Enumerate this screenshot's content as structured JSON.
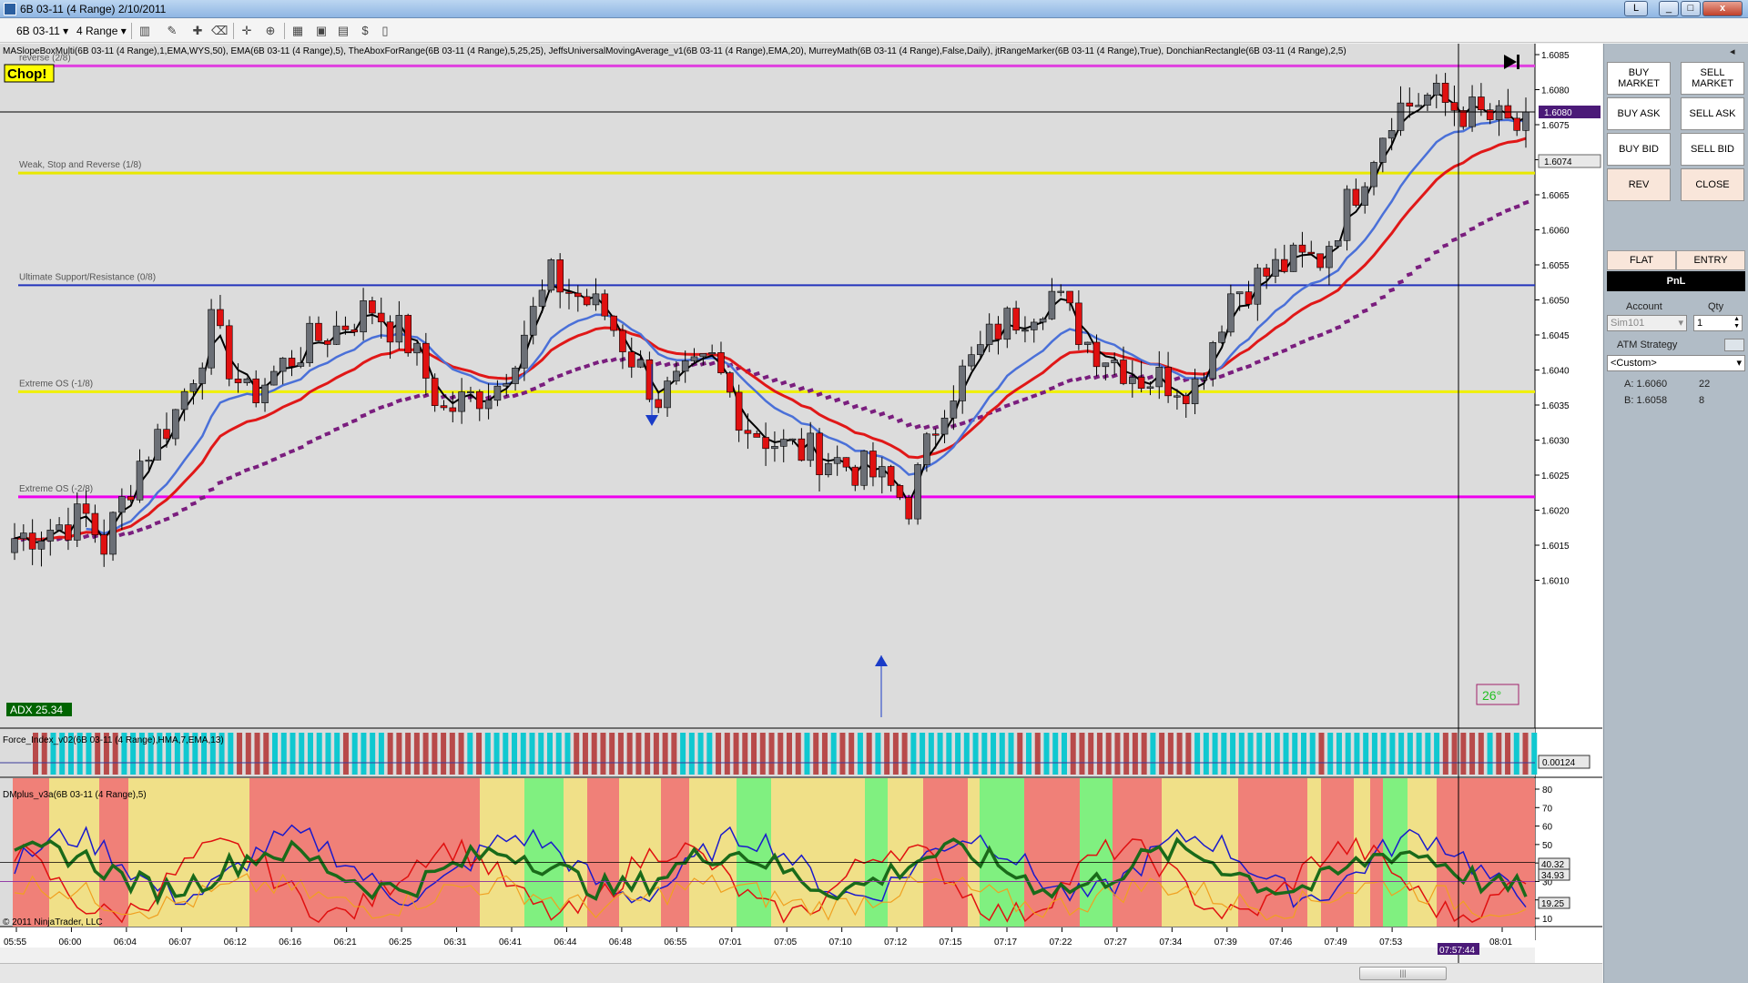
{
  "window": {
    "title": "6B 03-11 (4 Range)  2/10/2011",
    "buttons": [
      "L",
      "_",
      "□",
      "x"
    ]
  },
  "toolbar": {
    "instrument": "6B 03-11",
    "interval": "4 Range"
  },
  "chart": {
    "indicators_label": "MASlopeBoxMulti(6B 03-11 (4 Range),1,EMA,WYS,50), EMA(6B 03-11 (4 Range),5), TheAboxForRange(6B 03-11 (4 Range),5,25,25), JeffsUniversalMovingAverage_v1(6B 03-11 (4 Range),EMA,20), MurreyMath(6B 03-11 (4 Range),False,Daily), jtRangeMarker(6B 03-11 (4 Range),True), DonchianRectangle(6B 03-11 (4 Range),2,5)",
    "chop_label": "Chop!",
    "adx_label": "ADX 25.34",
    "angle_label": "26°",
    "murrey_lines": [
      {
        "label": "reverse (2/8)",
        "price": 1.60834,
        "color": "#e040e0"
      },
      {
        "label": "Weak, Stop and Reverse (1/8)",
        "price": 1.60681,
        "color": "#e8e800"
      },
      {
        "label": "Ultimate Support/Resistance (0/8)",
        "price": 1.60521,
        "color": "#2233bb"
      },
      {
        "label": "Extreme OS (-1/8)",
        "price": 1.60369,
        "color": "#f0f000"
      },
      {
        "label": "Extreme OS (-2/8)",
        "price": 1.60219,
        "color": "#ee00ee"
      }
    ],
    "price_axis": {
      "ticks": [
        "1.6085",
        "1.6080",
        "1.6075",
        "1.6070",
        "1.6065",
        "1.6060",
        "1.6055",
        "1.6050",
        "1.6045",
        "1.6040",
        "1.6035",
        "1.6030",
        "1.6025",
        "1.6020",
        "1.6015",
        "1.6010"
      ],
      "last_price_box": "1.6080",
      "current_price_box": "1.6074"
    },
    "time_axis": [
      "05:55",
      "06:00",
      "06:04",
      "06:07",
      "06:12",
      "06:16",
      "06:21",
      "06:25",
      "06:31",
      "06:41",
      "06:44",
      "06:48",
      "06:55",
      "07:01",
      "07:05",
      "07:10",
      "07:12",
      "07:15",
      "07:17",
      "07:22",
      "07:27",
      "07:34",
      "07:39",
      "07:46",
      "07:49",
      "07:53",
      "07:57:44",
      "08:01"
    ],
    "cursor_time": "07:57:44"
  },
  "force_panel": {
    "label": "Force_Index_v02(6B 03-11 (4 Range),HMA,7,EMA,13)",
    "value_box": "0.00124"
  },
  "dm_panel": {
    "label": "DMplus_v3a(6B 03-11 (4 Range),5)",
    "ticks": [
      "80",
      "70",
      "60",
      "50",
      "40",
      "30",
      "20",
      "10"
    ],
    "value_boxes": [
      "40.32",
      "34.93",
      "19.25"
    ],
    "copyright": "© 2011 NinjaTrader, LLC"
  },
  "side_panel": {
    "buttons": [
      "BUY MARKET",
      "SELL MARKET",
      "BUY ASK",
      "SELL ASK",
      "BUY BID",
      "SELL BID",
      "REV",
      "CLOSE"
    ],
    "tabs": [
      "FLAT",
      "ENTRY"
    ],
    "pnl": "PnL",
    "account_label": "Account",
    "qty_label": "Qty",
    "account_value": "Sim101",
    "qty_value": "1",
    "atm_label": "ATM Strategy",
    "atm_value": "<Custom>",
    "ask_label": "A: 1.6060",
    "ask_size": "22",
    "bid_label": "B: 1.6058",
    "bid_size": "8"
  },
  "colors": {
    "up_bar": "#6b6f76",
    "down_bar": "#e01010",
    "ema_fast": "#000000",
    "ema_slow": "#4a70d8",
    "jma": "#e01818",
    "murrey_trend": "#7a1e7e"
  }
}
